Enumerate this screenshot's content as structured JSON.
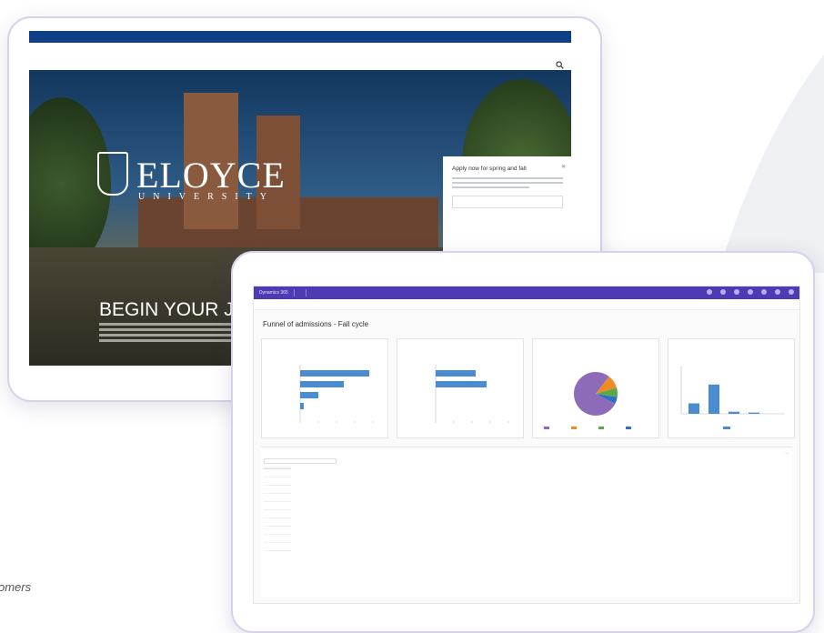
{
  "caption": "omers",
  "website": {
    "utility_links": [
      "",
      "",
      "",
      "",
      ""
    ],
    "nav_items": [
      "",
      "",
      "",
      "",
      "",
      ""
    ],
    "brand_name": "ELOYCE",
    "brand_sub": "UNIVERSITY",
    "headline": "BEGIN YOUR JO",
    "apply_panel": {
      "title": "Apply now for spring and fall",
      "field_label": ""
    },
    "icons": {
      "search": "search-icon",
      "close": "close-icon",
      "crest": "university-crest-icon"
    }
  },
  "dashboard": {
    "app_title": "Dynamics 365",
    "breadcrumb": [
      "",
      ""
    ],
    "toolbar_items": [
      "",
      "",
      "",
      "",
      "",
      ""
    ],
    "page_title": "Funnel of admissions - Fall cycle",
    "cards": [
      {
        "title": "",
        "subtitle": ""
      },
      {
        "title": "",
        "subtitle": ""
      },
      {
        "title": "",
        "subtitle": ""
      },
      {
        "title": "",
        "subtitle": ""
      }
    ],
    "grid": {
      "title": "",
      "search_placeholder": "",
      "columns": [
        "",
        "",
        ""
      ],
      "rows": [
        [
          "",
          "",
          ""
        ],
        [
          "",
          "",
          ""
        ],
        [
          "",
          "",
          ""
        ],
        [
          "",
          "",
          ""
        ],
        [
          "",
          "",
          ""
        ],
        [
          "",
          "",
          ""
        ],
        [
          "",
          "",
          ""
        ],
        [
          "",
          "",
          ""
        ],
        [
          "",
          "",
          ""
        ],
        [
          "",
          "",
          ""
        ]
      ],
      "footer_left": "",
      "footer_right": ""
    },
    "colors": {
      "accent": "#4e3ab4",
      "bar": "#4a8cd0",
      "pie_main": "#8e6bb8",
      "pie_orange": "#f08a24",
      "pie_green": "#5aa84a",
      "pie_blue": "#2d6fc2"
    }
  },
  "chart_data": [
    {
      "type": "bar",
      "orientation": "horizontal",
      "categories": [
        "",
        "",
        "",
        ""
      ],
      "values": [
        95,
        60,
        25,
        5
      ]
    },
    {
      "type": "bar",
      "orientation": "horizontal",
      "categories": [
        "",
        ""
      ],
      "values": [
        55,
        70
      ]
    },
    {
      "type": "pie",
      "labels": [
        "",
        "",
        "",
        ""
      ],
      "values": [
        78,
        10,
        7,
        5
      ]
    },
    {
      "type": "bar",
      "orientation": "vertical",
      "categories": [
        "",
        "",
        "",
        ""
      ],
      "values": [
        25,
        70,
        5,
        3
      ]
    }
  ]
}
